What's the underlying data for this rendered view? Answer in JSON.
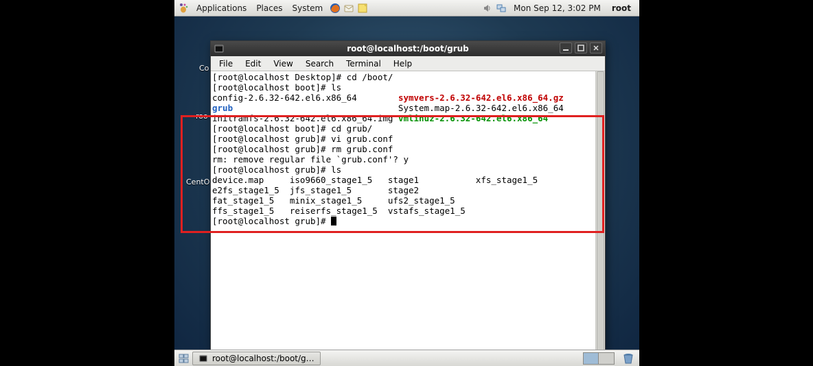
{
  "panel": {
    "applications": "Applications",
    "places": "Places",
    "system": "System",
    "clock": "Mon Sep 12,  3:02 PM",
    "user": "root"
  },
  "desk": {
    "frag1": "Co",
    "frag2": "roo",
    "frag3": "CentO"
  },
  "window": {
    "title": "root@localhost:/boot/grub",
    "menus": [
      "File",
      "Edit",
      "View",
      "Search",
      "Terminal",
      "Help"
    ]
  },
  "term": {
    "l01a": "[root@localhost Desktop]# ",
    "l01b": "cd /boot/",
    "l02a": "[root@localhost boot]# ",
    "l02b": "ls",
    "l03a": "config-2.6.32-642.el6.x86_64        ",
    "l03b": "symvers-2.6.32-642.el6.x86_64.gz",
    "l04a": "grub",
    "l04b": "                                System.map-2.6.32-642.el6.x86_64",
    "l05a": "initramfs-2.6.32-642.el6.x86_64.img ",
    "l05b": "vmlinuz-2.6.32-642.el6.x86_64",
    "l06a": "[root@localhost boot]# ",
    "l06b": "cd grub/",
    "l07a": "[root@localhost grub]# ",
    "l07b": "vi grub.conf",
    "l08a": "[root@localhost grub]# ",
    "l08b": "rm grub.conf",
    "l09": "rm: remove regular file `grub.conf'? y",
    "l10a": "[root@localhost grub]# ",
    "l10b": "ls",
    "l11": "device.map     iso9660_stage1_5   stage1           xfs_stage1_5",
    "l12": "e2fs_stage1_5  jfs_stage1_5       stage2",
    "l13": "fat_stage1_5   minix_stage1_5     ufs2_stage1_5",
    "l14": "ffs_stage1_5   reiserfs_stage1_5  vstafs_stage1_5",
    "l15": "[root@localhost grub]# "
  },
  "taskbar": {
    "task1": "root@localhost:/boot/g…"
  }
}
